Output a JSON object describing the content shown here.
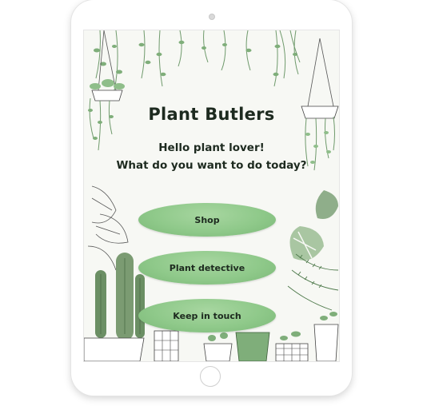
{
  "app": {
    "title": "Plant Butlers",
    "greeting_line1": "Hello plant lover!",
    "greeting_line2": "What do you want to do today?"
  },
  "menu": {
    "items": [
      {
        "label": "Shop"
      },
      {
        "label": "Plant detective"
      },
      {
        "label": "Keep in touch"
      }
    ]
  },
  "colors": {
    "button_fill": "#8fc98a",
    "plant_green": "#7fa87a",
    "text_dark": "#1d2a1f"
  },
  "icons": {
    "camera": "camera-dot-icon",
    "home": "home-button-icon"
  }
}
